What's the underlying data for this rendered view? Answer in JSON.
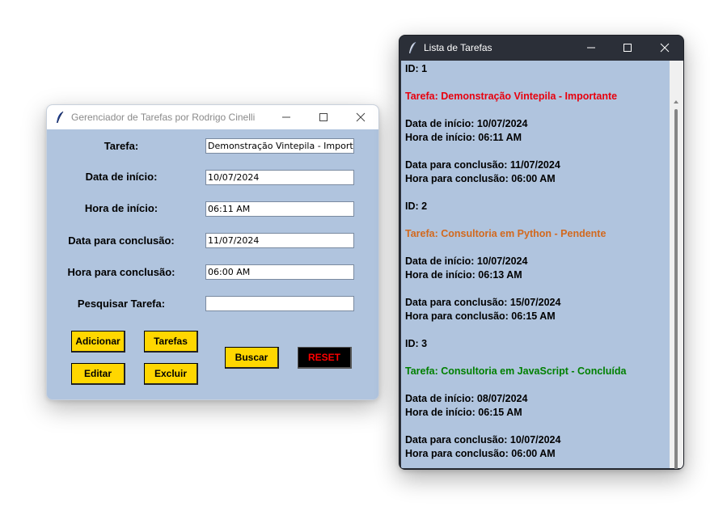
{
  "main_window": {
    "title": "Gerenciador de Tarefas por Rodrigo Cinelli",
    "labels": {
      "tarefa": "Tarefa:",
      "data_inicio": "Data de início:",
      "hora_inicio": "Hora de início:",
      "data_conclusao": "Data para conclusão:",
      "hora_conclusao": "Hora para conclusão:",
      "pesquisar": "Pesquisar Tarefa:"
    },
    "fields": {
      "tarefa": "Demonstração Vintepila - Importante",
      "data_inicio": "10/07/2024",
      "hora_inicio": "06:11 AM",
      "data_conclusao": "11/07/2024",
      "hora_conclusao": "06:00 AM",
      "pesquisar": ""
    },
    "buttons": {
      "adicionar": "Adicionar",
      "tarefas": "Tarefas",
      "editar": "Editar",
      "excluir": "Excluir",
      "buscar": "Buscar",
      "reset": "RESET"
    }
  },
  "list_window": {
    "title": "Lista de Tarefas",
    "tasks": [
      {
        "id": "ID: 1",
        "tarefa": "Tarefa: Demonstração Vintepila - Importante",
        "color": "#e8000d",
        "data_inicio": "Data de início: 10/07/2024",
        "hora_inicio": "Hora de início: 06:11 AM",
        "data_conclusao": "Data para conclusão: 11/07/2024",
        "hora_conclusao": "Hora para conclusão: 06:00 AM"
      },
      {
        "id": "ID: 2",
        "tarefa": "Tarefa: Consultoria em Python - Pendente",
        "color": "#d2691e",
        "data_inicio": "Data de início: 10/07/2024",
        "hora_inicio": "Hora de início: 06:13 AM",
        "data_conclusao": "Data para conclusão: 15/07/2024",
        "hora_conclusao": "Hora para conclusão: 06:15 AM"
      },
      {
        "id": "ID: 3",
        "tarefa": "Tarefa: Consultoria em JavaScript - Concluída",
        "color": "#008000",
        "data_inicio": "Data de início: 08/07/2024",
        "hora_inicio": "Hora de início: 06:15 AM",
        "data_conclusao": "Data para conclusão: 10/07/2024",
        "hora_conclusao": "Hora para conclusão: 06:00 AM"
      }
    ]
  },
  "colors": {
    "window_bg": "#b0c4de",
    "button_yellow": "#ffd700",
    "reset_bg": "#000000",
    "reset_text": "#ff0000"
  }
}
